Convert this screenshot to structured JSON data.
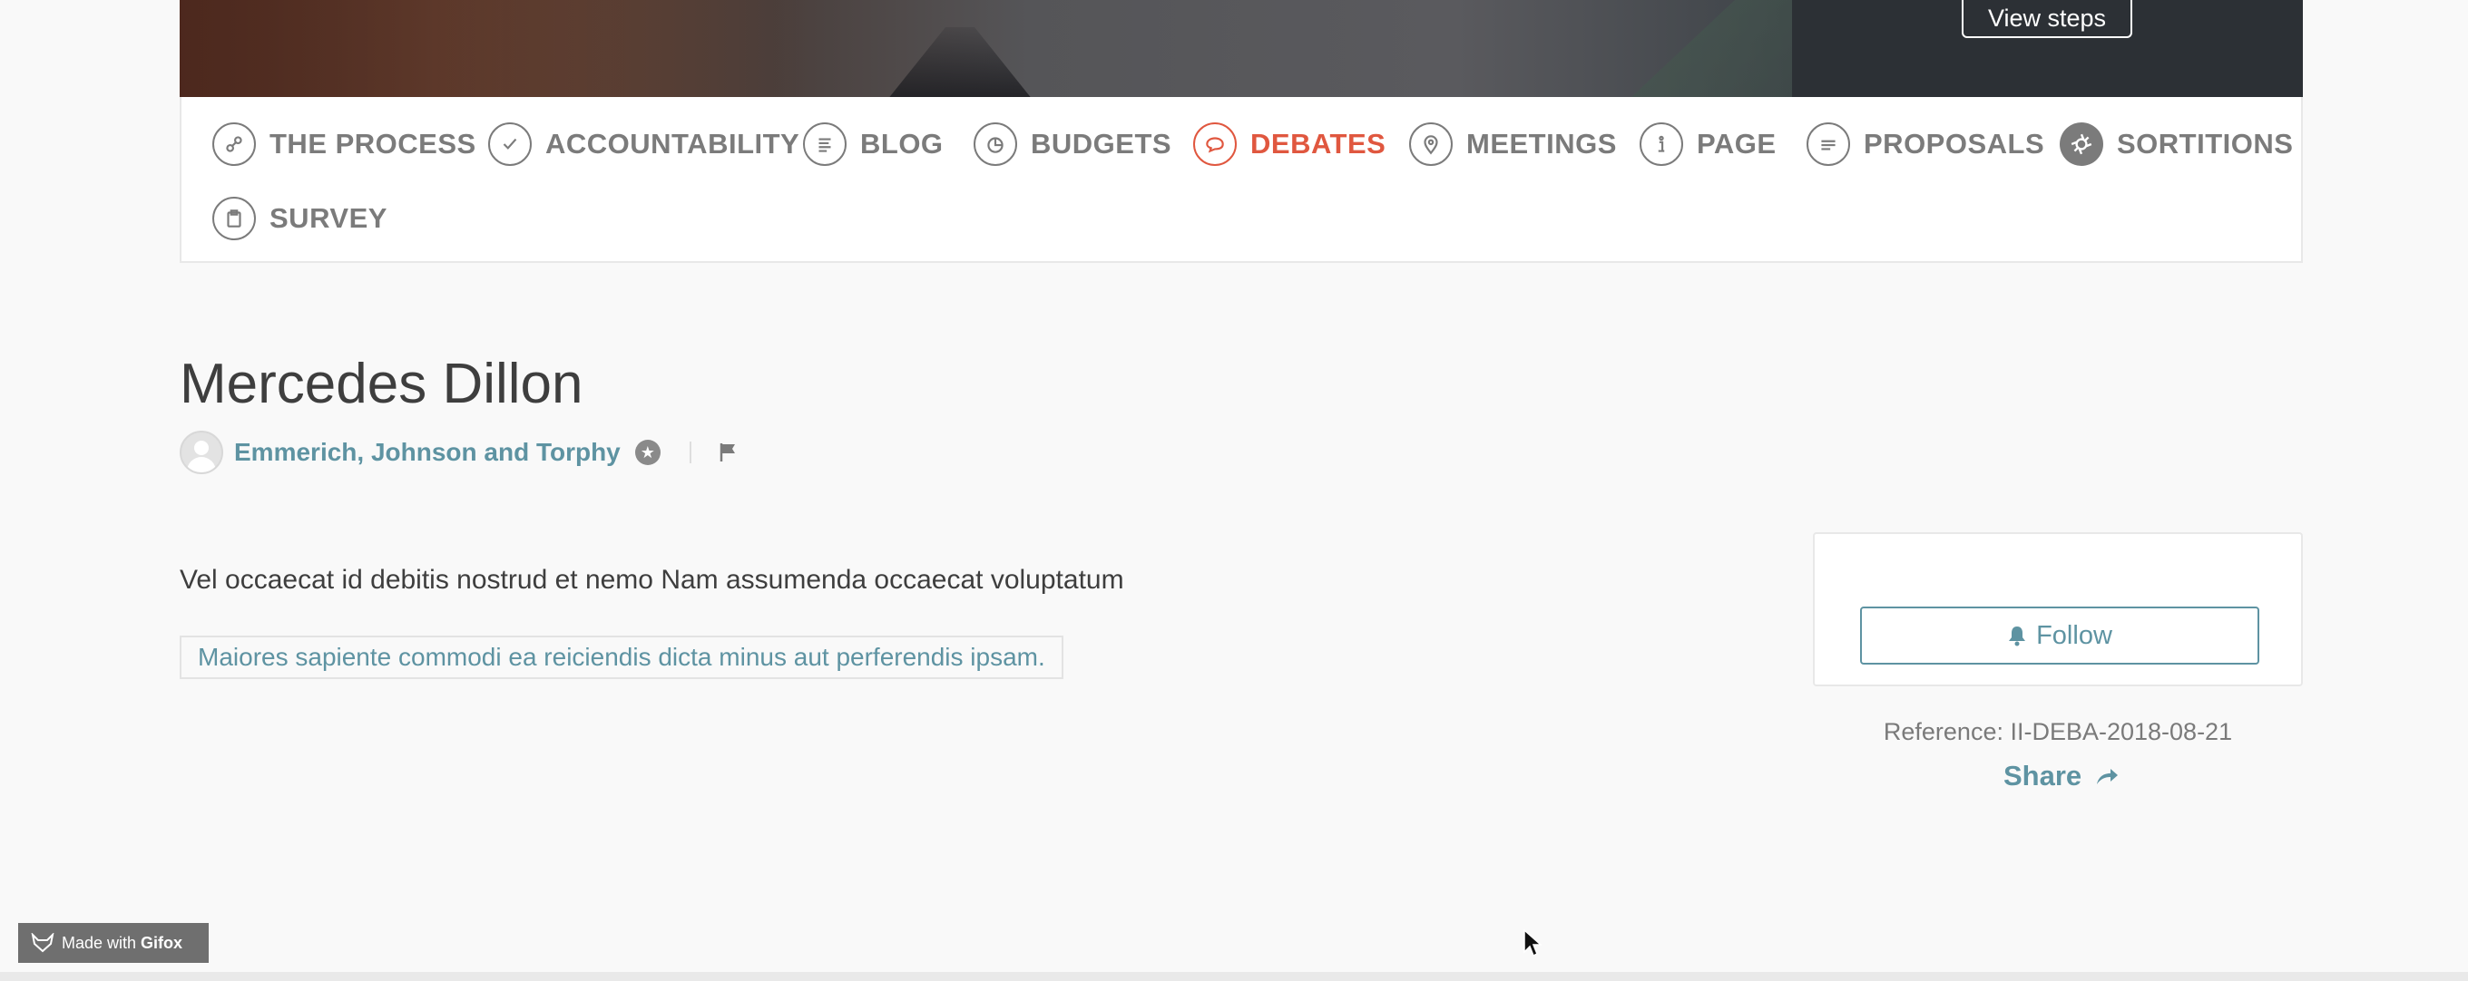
{
  "hero": {
    "view_steps_label": "View steps"
  },
  "tabs": [
    {
      "label": "THE PROCESS",
      "icon": "process-icon"
    },
    {
      "label": "ACCOUNTABILITY",
      "icon": "check-icon"
    },
    {
      "label": "BLOG",
      "icon": "blog-icon"
    },
    {
      "label": "BUDGETS",
      "icon": "budgets-pie-icon"
    },
    {
      "label": "DEBATES",
      "icon": "debates-speech-icon",
      "active": true
    },
    {
      "label": "MEETINGS",
      "icon": "map-pin-icon"
    },
    {
      "label": "PAGE",
      "icon": "info-icon"
    },
    {
      "label": "PROPOSALS",
      "icon": "proposals-icon"
    },
    {
      "label": "SORTITIONS",
      "icon": "aperture-icon"
    },
    {
      "label": "SURVEY",
      "icon": "clipboard-icon"
    }
  ],
  "debate": {
    "title": "Mercedes Dillon",
    "author": "Emmerich, Johnson and Torphy",
    "body": "Vel occaecat id debitis nostrud et nemo Nam assumenda occaecat voluptatum",
    "hashtag": "Maiores sapiente commodi ea reiciendis dicta minus aut perferendis ipsam."
  },
  "sidebar": {
    "follow_label": "Follow",
    "reference": "Reference: II-DEBA-2018-08-21",
    "share_label": "Share"
  },
  "footer": {
    "gifox_prefix": "Made with",
    "gifox_brand": "Gifox"
  },
  "colors": {
    "accent": "#5e93a2",
    "active_tab": "#e0573f",
    "tab_text": "#7b7b7b"
  }
}
